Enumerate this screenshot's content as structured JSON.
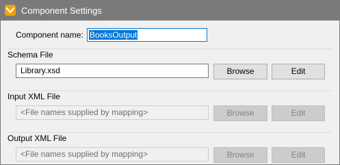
{
  "window": {
    "title": "Component Settings",
    "icon": "mapforce-logo-icon",
    "accent": "#f2a300"
  },
  "component": {
    "name_label": "Component name:",
    "name_value": "BooksOutput"
  },
  "schema": {
    "group_label": "Schema File",
    "value": "Library.xsd",
    "browse_label": "Browse",
    "edit_label": "Edit"
  },
  "input_xml": {
    "group_label": "Input XML File",
    "placeholder": "<File names supplied by mapping>",
    "browse_label": "Browse",
    "edit_label": "Edit"
  },
  "output_xml": {
    "group_label": "Output XML File",
    "placeholder": "<File names supplied by mapping>",
    "browse_label": "Browse",
    "edit_label": "Edit"
  }
}
